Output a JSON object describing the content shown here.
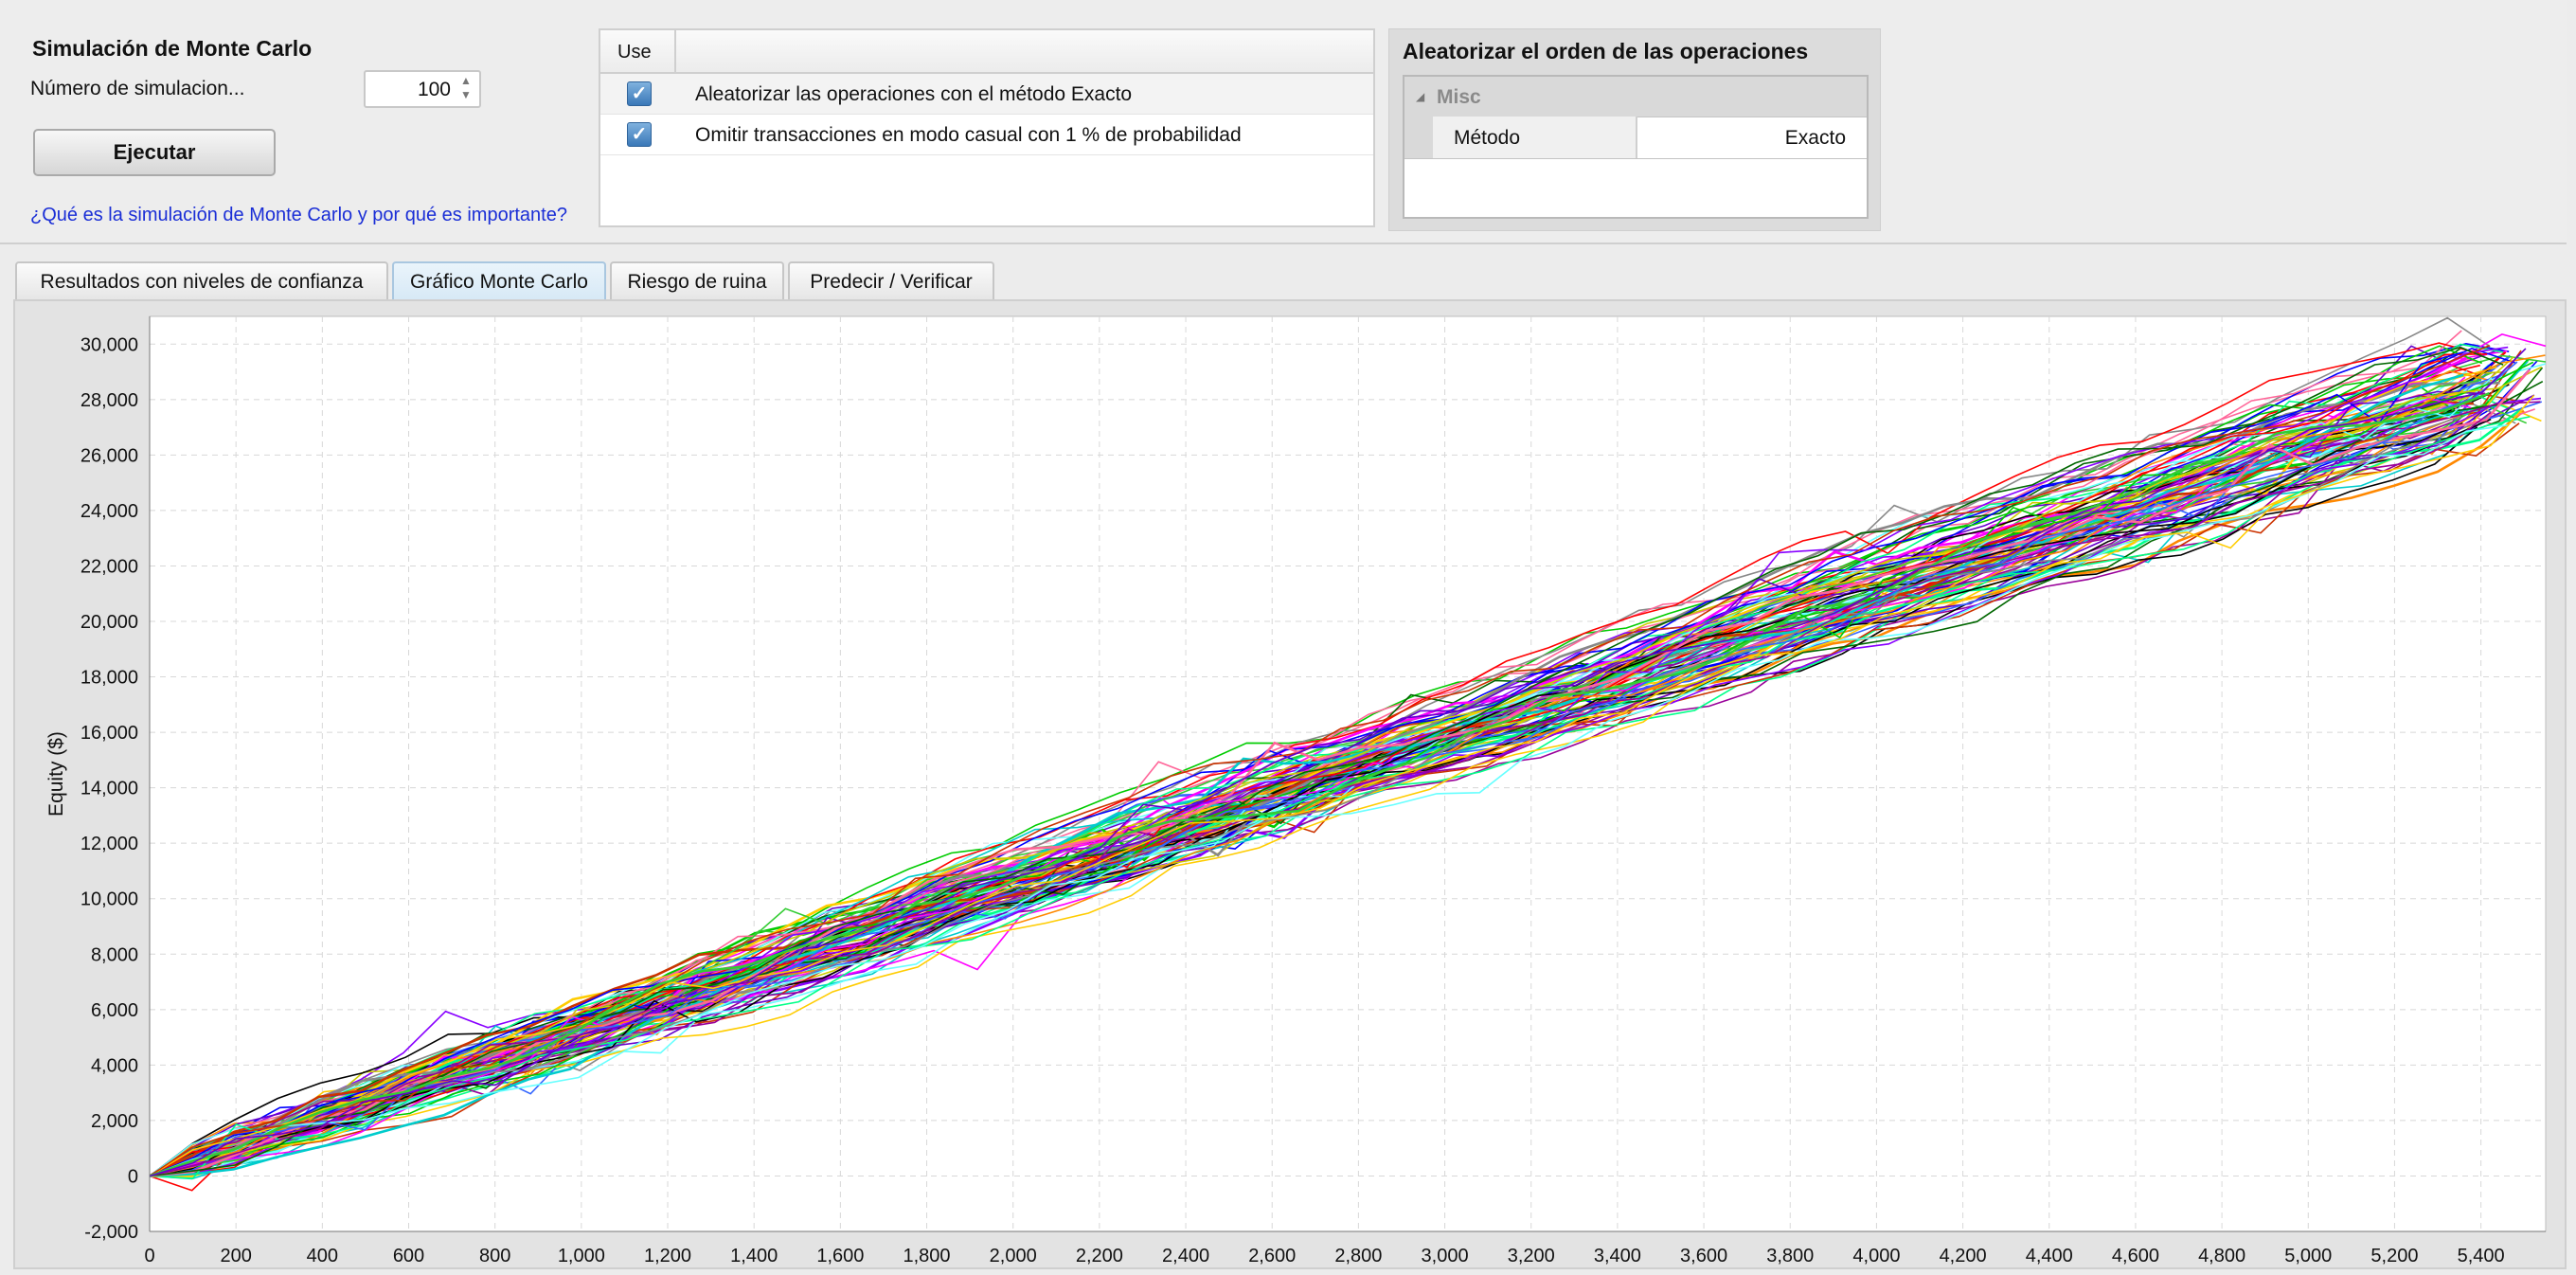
{
  "simulation": {
    "title": "Simulación de Monte Carlo",
    "num_label": "Número de simulacion...",
    "num_value": "100",
    "run_label": "Ejecutar",
    "link_text": "¿Qué es la simulación de Monte Carlo y por qué es importante?"
  },
  "options": {
    "header_use": "Use",
    "rows": [
      {
        "checked": true,
        "label": "Aleatorizar las operaciones con el método Exacto"
      },
      {
        "checked": true,
        "label": "Omitir transacciones en modo casual con 1 % de probabilidad"
      }
    ]
  },
  "properties": {
    "title": "Aleatorizar el orden de las operaciones",
    "group": "Misc",
    "rows": [
      {
        "name": "Método",
        "value": "Exacto"
      }
    ]
  },
  "tabs": [
    {
      "label": "Resultados con niveles de confianza",
      "active": false
    },
    {
      "label": "Gráfico Monte Carlo",
      "active": true
    },
    {
      "label": "Riesgo de ruina",
      "active": false
    },
    {
      "label": "Predecir / Verificar",
      "active": false
    }
  ],
  "chart_data": {
    "type": "line",
    "title": "",
    "xlabel": "",
    "ylabel": "Equity ($)",
    "xlim": [
      0,
      5550
    ],
    "ylim": [
      -2000,
      31000
    ],
    "grid": true,
    "legend": "none",
    "x_ticks": [
      "0",
      "200",
      "400",
      "600",
      "800",
      "1,000",
      "1,200",
      "1,400",
      "1,600",
      "1,800",
      "2,000",
      "2,200",
      "2,400",
      "2,600",
      "2,800",
      "3,000",
      "3,200",
      "3,400",
      "3,600",
      "3,800",
      "4,000",
      "4,200",
      "4,400",
      "4,600",
      "4,800",
      "5,000",
      "5,200",
      "5,400"
    ],
    "y_ticks": [
      "-2,000",
      "0",
      "2,000",
      "4,000",
      "6,000",
      "8,000",
      "10,000",
      "12,000",
      "14,000",
      "16,000",
      "18,000",
      "20,000",
      "22,000",
      "24,000",
      "26,000",
      "28,000",
      "30,000"
    ],
    "series_count": 100,
    "series_start": [
      0,
      0
    ],
    "series_end_range": [
      5350,
      5550,
      27000,
      30000
    ],
    "series_colors": [
      "#ff0000",
      "#00cc00",
      "#0000ff",
      "#ff00ff",
      "#00cccc",
      "#cccc00",
      "#000000",
      "#ff8800",
      "#8800ff",
      "#00ff88",
      "#888888",
      "#ff6699",
      "#006600",
      "#990099",
      "#3366ff",
      "#66ffff",
      "#ffcc00",
      "#cc3300",
      "#33cc33",
      "#6600cc"
    ]
  }
}
